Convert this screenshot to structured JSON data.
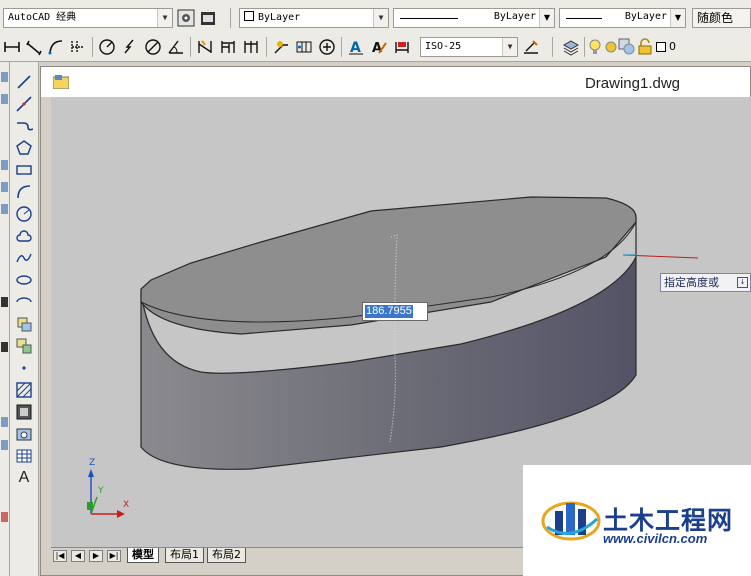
{
  "toolbar": {
    "workspace": "AutoCAD 经典",
    "color_control": "ByLayer",
    "linetype_control": "ByLayer",
    "lineweight_control": "ByLayer",
    "plotstyle_control": "随颜色",
    "dimstyle": "ISO-25",
    "layer_name": "0"
  },
  "drawing": {
    "file_name": "Drawing1.dwg",
    "dynamic_input_value": "186.7955",
    "prompt_text": "指定高度或",
    "ucs_labels": {
      "z": "Z",
      "y": "Y",
      "x": "X"
    }
  },
  "layout_tabs": {
    "model": "模型",
    "layout1": "布局1",
    "layout2": "布局2"
  },
  "watermark": {
    "title": "土木工程网",
    "url": "www.civilcn.com"
  },
  "left_toolbar": {
    "text_tool_glyph": "A"
  },
  "colors": {
    "viewport_bg": "#c6c6c6",
    "input_highlight": "#3b76c8",
    "brand_blue": "#1b3f8c"
  }
}
